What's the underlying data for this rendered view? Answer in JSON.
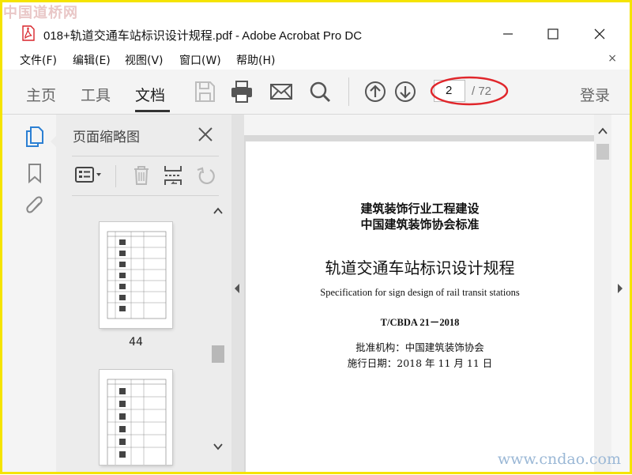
{
  "watermark": {
    "top": "中国道桥网",
    "bottom": "www.cndao.com"
  },
  "window": {
    "title": "018+轨道交通车站标识设计规程.pdf - Adobe Acrobat Pro DC"
  },
  "menu": {
    "items": [
      "文件(F)",
      "编辑(E)",
      "视图(V)",
      "窗口(W)",
      "帮助(H)"
    ],
    "close": "×"
  },
  "toolbar": {
    "tabs": [
      "主页",
      "工具",
      "文档"
    ],
    "active_tab": "文档",
    "current_page": "2",
    "total_pages": "/ 72",
    "login": "登录",
    "highlight_color": "#e0262b"
  },
  "panel": {
    "title": "页面缩略图",
    "thumbnails": [
      {
        "label": "44"
      },
      {
        "label": ""
      }
    ]
  },
  "document": {
    "org_line1": "建筑装饰行业工程建设",
    "org_line2": "中国建筑装饰协会标准",
    "title": "轨道交通车站标识设计规程",
    "title_en": "Specification for sign design of rail transit stations",
    "code": "T/CBDA 21－2018",
    "approver": "批准机构：中国建筑装饰协会",
    "effective_date": "施行日期：2018 年 11 月 11 日"
  },
  "colors": {
    "frame": "#f5e400",
    "pdf_icon": "#d8232a"
  }
}
